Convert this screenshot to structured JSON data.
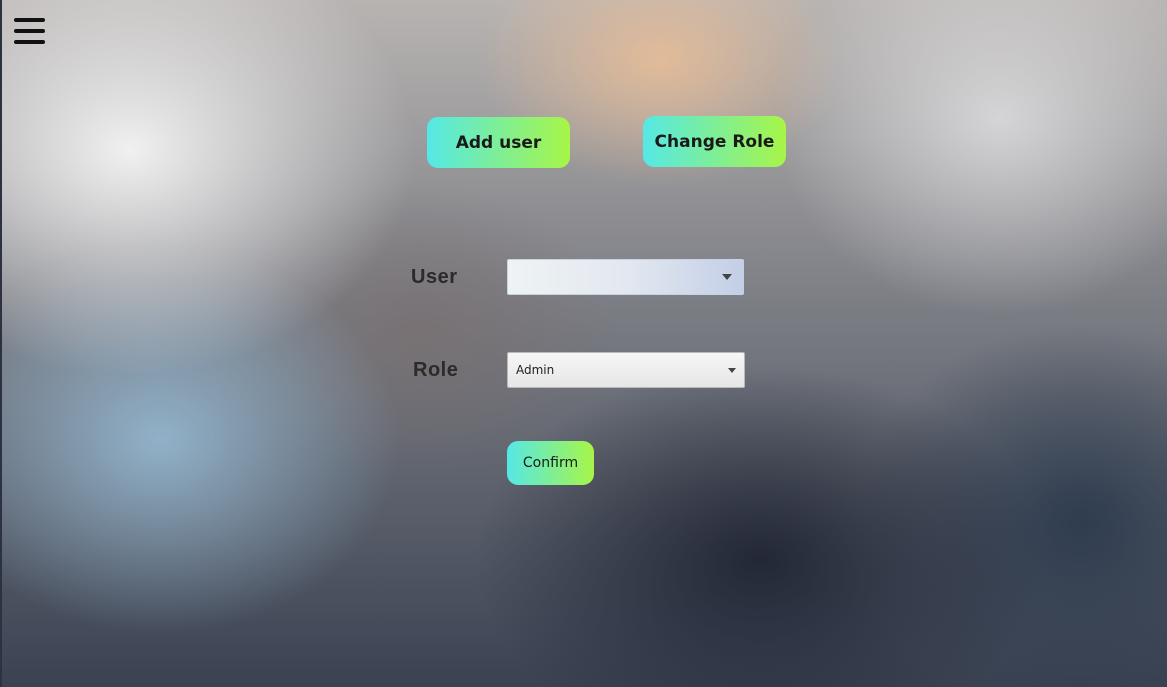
{
  "menu": {
    "icon": "hamburger-menu-icon"
  },
  "tabs": {
    "add_user_label": "Add user",
    "change_role_label": "Change Role"
  },
  "form": {
    "user_label": "User",
    "user_value": "",
    "role_label": "Role",
    "role_value": "Admin",
    "confirm_label": "Confirm"
  },
  "colors": {
    "button_gradient_start": "#55e8e6",
    "button_gradient_end": "#a7f547"
  }
}
